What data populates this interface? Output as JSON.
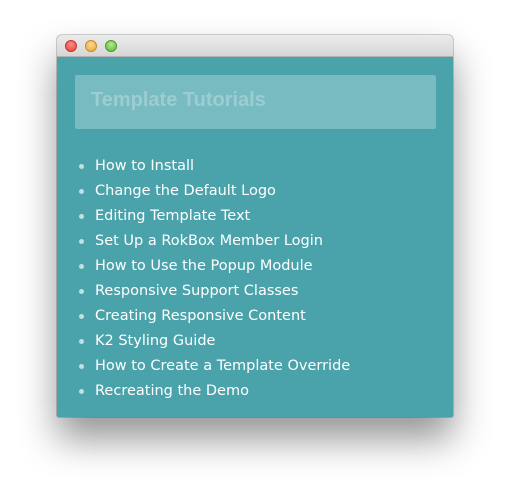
{
  "header": {
    "title": "Template Tutorials"
  },
  "tutorials": [
    {
      "label": "How to Install"
    },
    {
      "label": "Change the Default Logo"
    },
    {
      "label": "Editing Template Text"
    },
    {
      "label": "Set Up a RokBox Member Login"
    },
    {
      "label": "How to Use the Popup Module"
    },
    {
      "label": "Responsive Support Classes"
    },
    {
      "label": "Creating Responsive Content"
    },
    {
      "label": "K2 Styling Guide"
    },
    {
      "label": "How to Create a Template Override"
    },
    {
      "label": "Recreating the Demo"
    }
  ],
  "colors": {
    "background": "#4aa3ab",
    "header_box": "#78bbc1",
    "header_text": "#9ccdd2",
    "link_text": "#ffffff"
  }
}
